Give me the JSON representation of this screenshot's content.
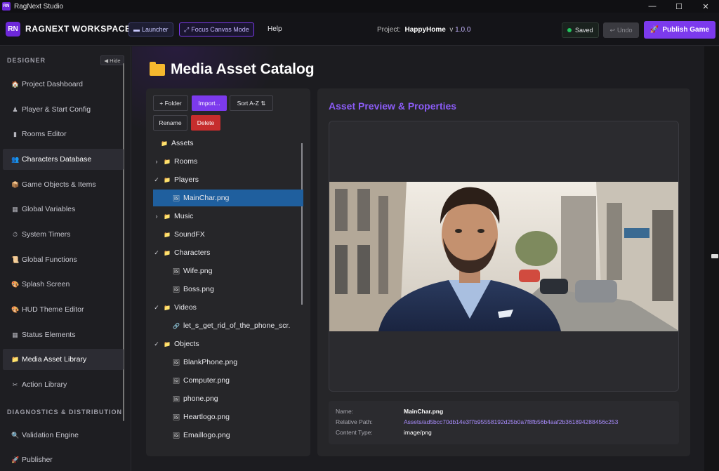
{
  "window": {
    "title": "RagNext Studio",
    "icon_text": "RN",
    "minimize": "—",
    "maximize": "☐",
    "close": "✕"
  },
  "header": {
    "logo": "RN",
    "brand": "RAGNEXT WORKSPACE",
    "launcher": "Launcher",
    "focus": "Focus Canvas Mode",
    "help": "Help",
    "project_label": "Project:",
    "project_name": "HappyHome",
    "version_label": "v",
    "version": "1.0.0",
    "saved": "Saved",
    "undo": "Undo",
    "publish": "Publish Game"
  },
  "sidebar": {
    "designer_heading": "DESIGNER",
    "hide": "Hide",
    "items": [
      {
        "label": "Project Dashboard",
        "icon": "🏠"
      },
      {
        "label": "Player & Start Config",
        "icon": "♟"
      },
      {
        "label": "Rooms Editor",
        "icon": "▮"
      },
      {
        "label": "Characters Database",
        "icon": "👥"
      },
      {
        "label": "Game Objects & Items",
        "icon": "📦"
      },
      {
        "label": "Global Variables",
        "icon": "▦"
      },
      {
        "label": "System Timers",
        "icon": "⏱"
      },
      {
        "label": "Global Functions",
        "icon": "📜"
      },
      {
        "label": "Splash Screen",
        "icon": "🎨"
      },
      {
        "label": "HUD Theme Editor",
        "icon": "🎨"
      },
      {
        "label": "Status Elements",
        "icon": "▦"
      },
      {
        "label": "Media Asset Library",
        "icon": "📁"
      },
      {
        "label": "Action Library",
        "icon": "✂"
      }
    ],
    "diag_heading": "DIAGNOSTICS & DISTRIBUTION",
    "diag_items": [
      {
        "label": "Validation Engine",
        "icon": "🔍"
      },
      {
        "label": "Publisher",
        "icon": "🚀"
      }
    ]
  },
  "main": {
    "title": "Media Asset Catalog",
    "toolbar": {
      "folder": "+ Folder",
      "import": "Import...",
      "sort": "Sort A-Z ⇅",
      "rename": "Rename",
      "delete": "Delete"
    },
    "tree": [
      {
        "label": "Assets",
        "expander": "",
        "icon": "📁"
      },
      {
        "label": "Rooms",
        "expander": "›",
        "icon": "📁"
      },
      {
        "label": "Players",
        "expander": "✓",
        "icon": "📁"
      },
      {
        "label": "MainChar.png",
        "expander": "",
        "icon": "🖼"
      },
      {
        "label": "Music",
        "expander": "›",
        "icon": "📁"
      },
      {
        "label": "SoundFX",
        "expander": "",
        "icon": "📁"
      },
      {
        "label": "Characters",
        "expander": "✓",
        "icon": "📁"
      },
      {
        "label": "Wife.png",
        "expander": "",
        "icon": "🖼"
      },
      {
        "label": "Boss.png",
        "expander": "",
        "icon": "🖼"
      },
      {
        "label": "Videos",
        "expander": "✓",
        "icon": "📁"
      },
      {
        "label": "let_s_get_rid_of_the_phone_scr.",
        "expander": "",
        "icon": "🔗"
      },
      {
        "label": "Objects",
        "expander": "✓",
        "icon": "📁"
      },
      {
        "label": "BlankPhone.png",
        "expander": "",
        "icon": "🖼"
      },
      {
        "label": "Computer.png",
        "expander": "",
        "icon": "🖼"
      },
      {
        "label": "phone.png",
        "expander": "",
        "icon": "🖼"
      },
      {
        "label": "Heartlogo.png",
        "expander": "",
        "icon": "🖼"
      },
      {
        "label": "Emaillogo.png",
        "expander": "",
        "icon": "🖼"
      }
    ],
    "preview_title": "Asset Preview & Properties",
    "props": {
      "name_k": "Name:",
      "name_v": "MainChar.png",
      "path_k": "Relative Path:",
      "path_v": "Assets/ad5bcc70db14e3f7b95558192d25b0a7f8fb56b4aaf2b361894288456c253",
      "type_k": "Content Type:",
      "type_v": "image/png"
    }
  }
}
